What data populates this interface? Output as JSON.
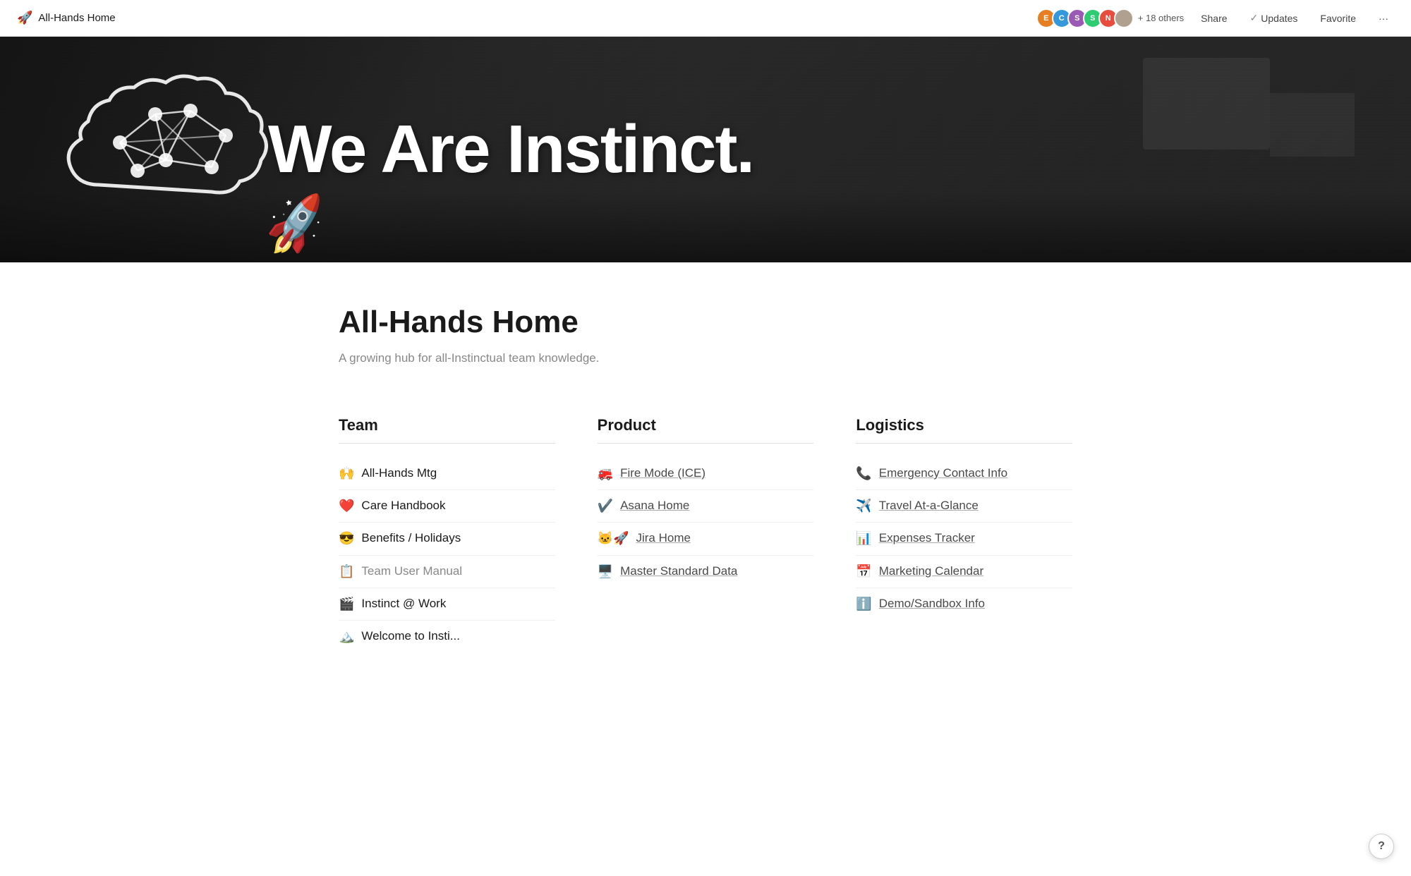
{
  "topnav": {
    "page_icon": "🚀",
    "title": "All-Hands Home",
    "avatars": [
      {
        "label": "E",
        "class": "avatar-e"
      },
      {
        "label": "C",
        "class": "avatar-c"
      },
      {
        "label": "S",
        "class": "avatar-s1"
      },
      {
        "label": "S",
        "class": "avatar-s2"
      },
      {
        "label": "N",
        "class": "avatar-n"
      }
    ],
    "others_count": "+ 18 others",
    "share_label": "Share",
    "updates_label": "Updates",
    "favorite_label": "Favorite",
    "more_label": "···"
  },
  "hero": {
    "title": "We Are Instinct.",
    "rocket_emoji": "🚀"
  },
  "page": {
    "emoji": "🚀",
    "title": "All-Hands Home",
    "subtitle": "A growing hub for all-Instinctual team knowledge."
  },
  "columns": [
    {
      "id": "team",
      "header": "Team",
      "items": [
        {
          "emoji": "🙌",
          "label": "All-Hands Mtg",
          "style": "normal"
        },
        {
          "emoji": "❤️",
          "label": "Care Handbook",
          "style": "normal"
        },
        {
          "emoji": "😎",
          "label": "Benefits / Holidays",
          "style": "normal"
        },
        {
          "emoji": "📋",
          "label": "Team User Manual",
          "style": "muted"
        },
        {
          "emoji": "🎬",
          "label": "Instinct @ Work",
          "style": "normal"
        },
        {
          "emoji": "🏔️",
          "label": "Welcome to Insti...",
          "style": "normal"
        }
      ]
    },
    {
      "id": "product",
      "header": "Product",
      "items": [
        {
          "emoji": "🚒",
          "label": "Fire Mode (ICE)",
          "style": "linked"
        },
        {
          "emoji": "✔️",
          "label": "Asana Home",
          "style": "linked"
        },
        {
          "emoji": "🐱🚀",
          "label": "Jira Home",
          "style": "linked"
        },
        {
          "emoji": "🖥️",
          "label": "Master Standard Data",
          "style": "linked"
        }
      ]
    },
    {
      "id": "logistics",
      "header": "Logistics",
      "items": [
        {
          "emoji": "📞",
          "label": "Emergency Contact Info",
          "style": "linked"
        },
        {
          "emoji": "✈️",
          "label": "Travel At-a-Glance",
          "style": "linked"
        },
        {
          "emoji": "📊",
          "label": "Expenses Tracker",
          "style": "linked"
        },
        {
          "emoji": "📅",
          "label": "Marketing Calendar",
          "style": "linked"
        },
        {
          "emoji": "ℹ️",
          "label": "Demo/Sandbox Info",
          "style": "linked"
        }
      ]
    }
  ],
  "help": {
    "label": "?"
  }
}
